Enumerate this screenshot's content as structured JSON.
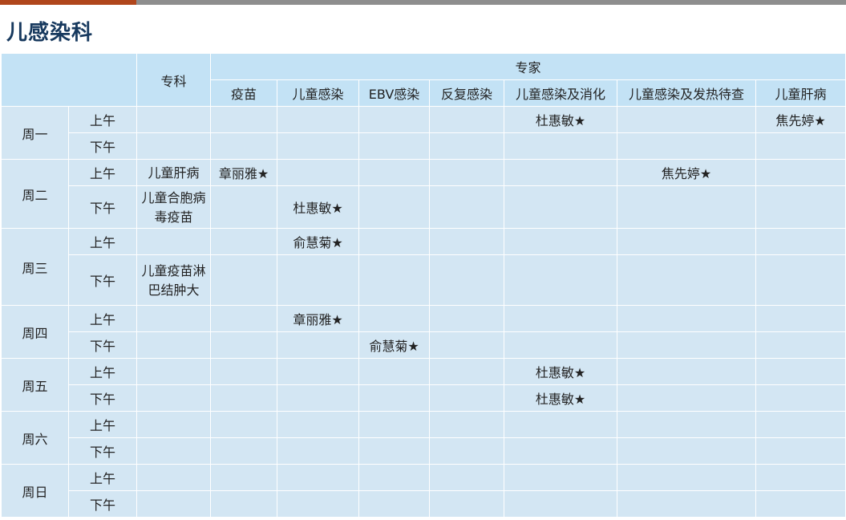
{
  "page": {
    "title": "儿感染科"
  },
  "header": {
    "specialty_label": "专科",
    "experts_label": "专家",
    "columns": [
      "疫苗",
      "儿童感染",
      "EBV感染",
      "反复感染",
      "儿童感染及消化",
      "儿童感染及发热待查",
      "儿童肝病"
    ]
  },
  "days": [
    {
      "day": "周一",
      "am_label": "上午",
      "pm_label": "下午",
      "am": {
        "specialty": "",
        "cells": [
          "",
          "",
          "",
          "",
          "杜惠敏★",
          "",
          "焦先婷★"
        ]
      },
      "pm": {
        "specialty": "",
        "cells": [
          "",
          "",
          "",
          "",
          "",
          "",
          ""
        ]
      }
    },
    {
      "day": "周二",
      "am_label": "上午",
      "pm_label": "下午",
      "am": {
        "specialty": "儿童肝病",
        "cells": [
          "章丽雅★",
          "",
          "",
          "",
          "",
          "焦先婷★",
          ""
        ]
      },
      "pm": {
        "specialty": "儿童合胞病毒疫苗",
        "cells": [
          "",
          "杜惠敏★",
          "",
          "",
          "",
          "",
          ""
        ]
      }
    },
    {
      "day": "周三",
      "am_label": "上午",
      "pm_label": "下午",
      "am": {
        "specialty": "",
        "cells": [
          "",
          "俞慧菊★",
          "",
          "",
          "",
          "",
          ""
        ]
      },
      "pm": {
        "specialty": "儿童疫苗淋巴结肿大",
        "cells": [
          "",
          "",
          "",
          "",
          "",
          "",
          ""
        ]
      }
    },
    {
      "day": "周四",
      "am_label": "上午",
      "pm_label": "下午",
      "am": {
        "specialty": "",
        "cells": [
          "",
          "章丽雅★",
          "",
          "",
          "",
          "",
          ""
        ]
      },
      "pm": {
        "specialty": "",
        "cells": [
          "",
          "",
          "俞慧菊★",
          "",
          "",
          "",
          ""
        ]
      }
    },
    {
      "day": "周五",
      "am_label": "上午",
      "pm_label": "下午",
      "am": {
        "specialty": "",
        "cells": [
          "",
          "",
          "",
          "",
          "杜惠敏★",
          "",
          ""
        ]
      },
      "pm": {
        "specialty": "",
        "cells": [
          "",
          "",
          "",
          "",
          "杜惠敏★",
          "",
          ""
        ]
      }
    },
    {
      "day": "周六",
      "am_label": "上午",
      "pm_label": "下午",
      "am": {
        "specialty": "",
        "cells": [
          "",
          "",
          "",
          "",
          "",
          "",
          ""
        ]
      },
      "pm": {
        "specialty": "",
        "cells": [
          "",
          "",
          "",
          "",
          "",
          "",
          ""
        ]
      }
    },
    {
      "day": "周日",
      "am_label": "上午",
      "pm_label": "下午",
      "am": {
        "specialty": "",
        "cells": [
          "",
          "",
          "",
          "",
          "",
          "",
          ""
        ]
      },
      "pm": {
        "specialty": "",
        "cells": [
          "",
          "",
          "",
          "",
          "",
          "",
          ""
        ]
      }
    }
  ],
  "colors": {
    "header_bg": "#c3e2f5",
    "cell_bg": "#d3e6f3",
    "title_color": "#17395e",
    "accent_bar": "#b0461c",
    "top_bar": "#8e8e8e"
  }
}
